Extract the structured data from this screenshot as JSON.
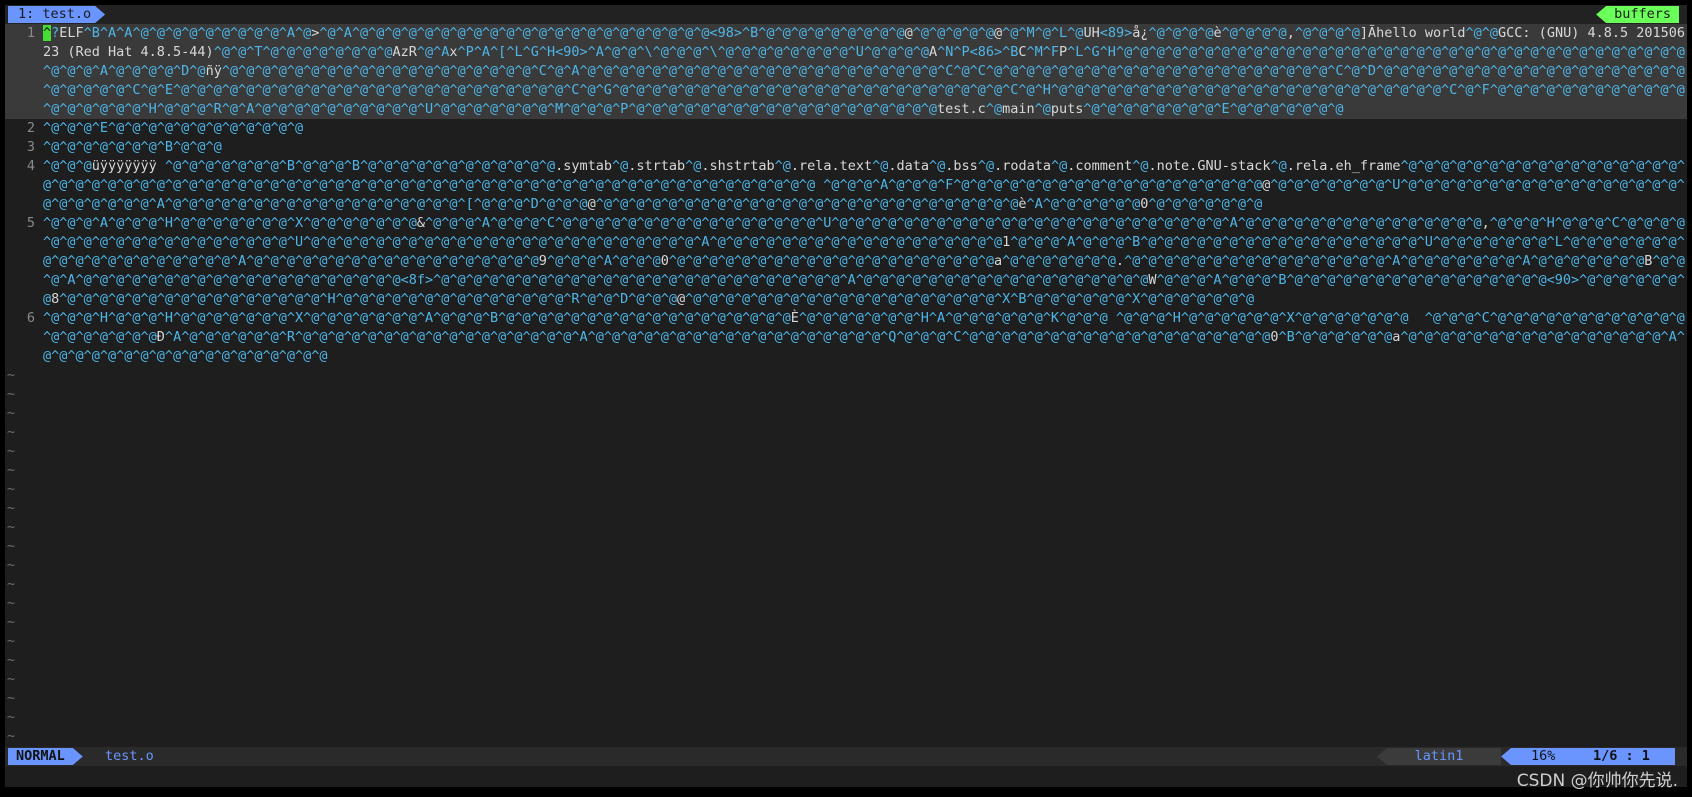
{
  "tabline": {
    "active_tab": "1: test.o",
    "buffers_label": "buffers"
  },
  "colors": {
    "background": "#1e1e1e",
    "control_chars": "#4fb6e8",
    "plain_text": "#d8d8d8",
    "cursor": "#44dd33",
    "accent_blue": "#6a95ff",
    "accent_green": "#6bff5a"
  },
  "editor": {
    "lines": [
      {
        "num": "1",
        "current": true,
        "segments": [
          {
            "t": "^",
            "k": "cursor"
          },
          {
            "t": "?",
            "k": "ctl"
          },
          {
            "t": "ELF",
            "k": "txt"
          },
          {
            "t": "^B^A^A^@^@^@^@^@^@^@^@^@^A^@",
            "k": "ctl"
          },
          {
            "t": ">",
            "k": "txt"
          },
          {
            "t": "^@^A^@^@^@^@^@^@^@^@^@^@^@^@^@^@^@^@^@^@^@^@^@^@<98>^B^@^@^@^@^@^@^@^@^@",
            "k": "ctl"
          },
          {
            "t": "@",
            "k": "txt"
          },
          {
            "t": "^@^@^@^@^@",
            "k": "ctl"
          },
          {
            "t": "@",
            "k": "txt"
          },
          {
            "t": "^@^M^@^L^@",
            "k": "ctl"
          },
          {
            "t": "UH",
            "k": "txt"
          },
          {
            "t": "<89>",
            "k": "ctl"
          },
          {
            "t": "å¿",
            "k": "txt"
          },
          {
            "t": "^@^@^@^@",
            "k": "ctl"
          },
          {
            "t": "è",
            "k": "txt"
          },
          {
            "t": "^@^@^@^@",
            "k": "ctl"
          },
          {
            "t": ",",
            "k": "txt"
          },
          {
            "t": "^@^@^@^@",
            "k": "ctl"
          },
          {
            "t": "]Ãhello world",
            "k": "txt"
          },
          {
            "t": "^@^@",
            "k": "ctl"
          },
          {
            "t": "GCC: (GNU) 4.8.5 20150623 (Red Hat 4.8.5-44)",
            "k": "txt"
          },
          {
            "t": "^@^@^T^@^@^@^@^@^@^@^@",
            "k": "ctl"
          },
          {
            "t": "AzR",
            "k": "txt"
          },
          {
            "t": "^@^A",
            "k": "ctl"
          },
          {
            "t": "x",
            "k": "txt"
          },
          {
            "t": "^P^A^[^L^G^H<90>^A^@^@^\\^@^@^@^\\^@^@^@^@^@^@^@^@^U^@^@^@^@",
            "k": "ctl"
          },
          {
            "t": "A",
            "k": "txt"
          },
          {
            "t": "^N^P<86>^B",
            "k": "ctl"
          },
          {
            "t": "C",
            "k": "txt"
          },
          {
            "t": "^M^F",
            "k": "ctl"
          },
          {
            "t": "P",
            "k": "txt"
          },
          {
            "t": "^L^G^H^@^@^@^@^@^@^@^@^@^@^@^@^@^@^@^@^@^@^@^@^@^@^@^@^@^@^@^@^@^@^@^@^@^@^@^@^@^@^A^@^@^@^@^D^@",
            "k": "ctl"
          },
          {
            "t": "ñÿ",
            "k": "txt"
          },
          {
            "t": "^@^@^@^@^@^@^@^@^@^@^@^@^@^@^@^@^@^@^@^C^@^A^@^@^@^@^@^@^@^@^@^@^@^@^@^@^@^@^@^@^@^@^@^@^C^@^C^@^@^@^@^@^@^@^@^@^@^@^@^@^@^@^@^@^@^@^@^@^C^@^D^@^@^@^@^@^@^@^@^@^@^@^@^@^@^@^@^@^@^@^@^@^@^@^@^C^@^E^@^@^@^@^@^@^@^@^@^@^@^@^@^@^@^@^@^@^@^@^@^@^@^@^C^@^G^@^@^@^@^@^@^@^@^@^@^@^@^@^@^@^@^@^@^@^@^@^@^@^@^C^@^H^@^@^@^@^@^@^@^@^@^@^@^@^@^@^@^@^@^@^@^@^@^@^@^@^C^@^F^@^@^@^@^@^@^@^@^@^@^@^@^@^@^@^@^@^@^H^@^@^@^R^@^A^@^@^@^@^@^@^@^@^@^@^U^@^@^@^@^@^@^@^M^@^@^@^P^@^@^@^@^@^@^@^@^@^@^@^@^@^@^@^@^@^@^@",
            "k": "ctl"
          },
          {
            "t": "test.c",
            "k": "txt"
          },
          {
            "t": "^@",
            "k": "ctl"
          },
          {
            "t": "main",
            "k": "txt"
          },
          {
            "t": "^@",
            "k": "ctl"
          },
          {
            "t": "puts",
            "k": "txt"
          },
          {
            "t": "^@^@^@^@^@^@^@^@^E^@^@^@^@^@^@^@",
            "k": "ctl"
          }
        ]
      },
      {
        "num": "2",
        "current": false,
        "segments": [
          {
            "t": "^@^@^@^E^@^@^@^@^@^@^@^@^@^@^@^@",
            "k": "ctl"
          }
        ]
      },
      {
        "num": "3",
        "current": false,
        "segments": [
          {
            "t": "^@^@^@^@^@^@^@^B^@^@^@",
            "k": "ctl"
          }
        ]
      },
      {
        "num": "4",
        "current": false,
        "segments": [
          {
            "t": "^@^@^@",
            "k": "ctl"
          },
          {
            "t": "üÿÿÿÿÿÿÿ ",
            "k": "txt"
          },
          {
            "t": "^@^@^@^@^@^@^@^B^@^@^@^B^@^@^@^@^@^@^@^@^@^@^@^@",
            "k": "ctl"
          },
          {
            "t": ".symtab",
            "k": "txt"
          },
          {
            "t": "^@",
            "k": "ctl"
          },
          {
            "t": ".strtab",
            "k": "txt"
          },
          {
            "t": "^@",
            "k": "ctl"
          },
          {
            "t": ".shstrtab",
            "k": "txt"
          },
          {
            "t": "^@",
            "k": "ctl"
          },
          {
            "t": ".rela.text",
            "k": "txt"
          },
          {
            "t": "^@",
            "k": "ctl"
          },
          {
            "t": ".data",
            "k": "txt"
          },
          {
            "t": "^@",
            "k": "ctl"
          },
          {
            "t": ".bss",
            "k": "txt"
          },
          {
            "t": "^@",
            "k": "ctl"
          },
          {
            "t": ".rodata",
            "k": "txt"
          },
          {
            "t": "^@",
            "k": "ctl"
          },
          {
            "t": ".comment",
            "k": "txt"
          },
          {
            "t": "^@",
            "k": "ctl"
          },
          {
            "t": ".note.GNU-stack",
            "k": "txt"
          },
          {
            "t": "^@",
            "k": "ctl"
          },
          {
            "t": ".rela.eh_frame",
            "k": "txt"
          },
          {
            "t": "^@^@^@^@^@^@^@^@^@^@^@^@^@^@^@^@^@^@^@^@^@^@^@^@^@^@^@^@^@^@^@^@^@^@^@^@^@^@^@^@^@^@^@^@^@^@^@^@^@^@^@^@^@^@^@^@^@^@^@^@^@^@^@^@^@ ^@^@^@^A^@^@^@^F^@^@^@^@^@^@^@^@^@^@^@^@^@^@^@^@^@^@^@",
            "k": "ctl"
          },
          {
            "t": "@",
            "k": "txt"
          },
          {
            "t": "^@^@^@^@^@^@^@^U^@^@^@^@^@^@^@^@^@^@^@^@^@^@^@^@^@^@^@^@^@^@^@^@^A^@^@^@^@^@^@^@^@^@^@^@^@^@^@^@^@^@^@^[^@^@^@^D^@^@^@",
            "k": "ctl"
          },
          {
            "t": "@",
            "k": "txt"
          },
          {
            "t": "^@^@^@^@^@^@^@^@^@^@^@^@^@^@^@^@^@^@^@^@^@^@^@^@^@^@",
            "k": "ctl"
          },
          {
            "t": "è",
            "k": "txt"
          },
          {
            "t": "^A^@^@^@^@^@^@",
            "k": "ctl"
          },
          {
            "t": "0",
            "k": "txt"
          },
          {
            "t": "^@^@^@^@^@^@^@",
            "k": "ctl"
          }
        ]
      },
      {
        "num": "5",
        "current": false,
        "segments": [
          {
            "t": "^@^@^@^A^@^@^@^H^@^@^@^@^@^@^@^X^@^@^@^@^@^@^@",
            "k": "ctl"
          },
          {
            "t": "&",
            "k": "txt"
          },
          {
            "t": "^@^@^@^A^@^@^@^C^@^@^@^@^@^@^@^@^@^@^@^@^@^@^@^@^U^@^@^@^@^@^@^@^@^@^@^@^@^@^@^@^@^@^@^@^@^@^@^@^@^A^@^@^@^@^@^@^@^@^@^@^@^@^@^@^@",
            "k": "ctl"
          },
          {
            "t": ",",
            "k": "txt"
          },
          {
            "t": "^@^@^@^H^@^@^@^C^@^@^@^@^@^@^@^@^@^@^@^@^@^@^@^@^@^@^@^U^@^@^@^@^@^@^@^@^@^@^@^@^@^@^@^@^@^@^@^@^@^@^@^@^A^@^@^@^@^@^@^@^@^@^@^@^@^@^@^@^@^@^@",
            "k": "ctl"
          },
          {
            "t": "1",
            "k": "txt"
          },
          {
            "t": "^@^@^@^A^@^@^@^B^@^@^@^@^@^@^@^@^@^@^@^@^@^@^@^@^@^U^@^@^@^@^@^@^@^L^@^@^@^@^@^@^@^@^@^@^@^@^@^@^@^@^@^@^@^A^@^@^@^@^@^@^@^@^@^@^@^@^@^@^@^@^@^@",
            "k": "ctl"
          },
          {
            "t": "9",
            "k": "txt"
          },
          {
            "t": "^@^@^@^A^@^@^@",
            "k": "ctl"
          },
          {
            "t": "0",
            "k": "txt"
          },
          {
            "t": "^@^@^@^@^@^@^@^@^@^@^@^@^@^@^@^@^@^@^@^@",
            "k": "ctl"
          },
          {
            "t": "a",
            "k": "txt"
          },
          {
            "t": "^@^@^@^@^@^@^@",
            "k": "ctl"
          },
          {
            "t": ".",
            "k": "txt"
          },
          {
            "t": "^@^@^@^@^@^@^@^@^@^@^@^@^@^@^@^@^A^@^@^@^@^@^@^@^A^@^@^@^@^@^@^@",
            "k": "ctl"
          },
          {
            "t": "B",
            "k": "txt"
          },
          {
            "t": "^@^@^@^A^@^@^@^@^@^@^@^@^@^@^@^@^@^@^@^@^@^@^@^@<8f>^@^@^@^@^@^@^@^@^@^@^@^@^@^@^@^@^@^@^@^@^@^@^@^@^@^A^@^@^@^@^@^@^@^@^@^@^@^@^@^@^@^@^@^@",
            "k": "ctl"
          },
          {
            "t": "W",
            "k": "txt"
          },
          {
            "t": "^@^@^@^A^@^@^@^B^@^@^@^@^@^@^@^@^@^@^@^@^@^@^@^@<90>^@^@^@^@^@^@^@",
            "k": "ctl"
          },
          {
            "t": "8",
            "k": "txt"
          },
          {
            "t": "^@^@^@^@^@^@^@^@^@^@^@^@^@^@^@^@^H^@^@^@^@^@^@^@^@^@^@^@^@^@^@^R^@^@^D^@^@^@",
            "k": "ctl"
          },
          {
            "t": "@",
            "k": "txt"
          },
          {
            "t": "^@^@^@^@^@^@^@^@^@^@^@^@^@^@^@^@^@^@^@^X^B^@^@^@^@^@^@^X^@^@^@^@^@^@^@",
            "k": "ctl"
          }
        ]
      },
      {
        "num": "6",
        "current": false,
        "segments": [
          {
            "t": "^@^@^@^H^@^@^@^H^@^@^@^@^@^@^@^X^@^@^@^@^@^@^@^A^@^@^@^B^@^@^@^@^@^@^@^@^@^@^@^@^@^@^@^@^@^@",
            "k": "ctl"
          },
          {
            "t": "È",
            "k": "txt"
          },
          {
            "t": "^@^@^@^@^@^@^@^H^A^@^@^@^@^@^@^K^@^@^@ ^@^@^@^H^@^@^@^@^@^@^X^@^@^@^@^@^@^@  ^@^@^@^C^@^@^@^@^@^@^@^@^@^@^@^@^@^@^@^@^@^@^@",
            "k": "ctl"
          },
          {
            "t": "Ð",
            "k": "txt"
          },
          {
            "t": "^A^@^@^@^@^@^@^R^@^@^@^@^@^@^@^@^@^@^@^@^@^@^@^@^@^A^@^@^@^@^@^@^@^@^@^@^@^@^@^@^@^@^@^@^Q^@^@^@^C^@^@^@^@^@^@^@^@^@^@^@^@^@^@^@^@^@^@^@",
            "k": "ctl"
          },
          {
            "t": "0",
            "k": "txt"
          },
          {
            "t": "^B^@^@^@^@^@^@",
            "k": "ctl"
          },
          {
            "t": "a",
            "k": "txt"
          },
          {
            "t": "^@^@^@^@^@^@^@^@^@^@^@^@^@^@^@^@^A^@^@^@^@^@^@^@^@^@^@^@^@^@^@^@^@^@^@",
            "k": "ctl"
          }
        ]
      }
    ],
    "filler_lines": [
      "~",
      "~",
      "~",
      "~",
      "~",
      "~",
      "~",
      "~",
      "~",
      "~",
      "~",
      "~",
      "~",
      "~",
      "~",
      "~",
      "~",
      "~",
      "~",
      "~"
    ]
  },
  "statusline": {
    "mode": "NORMAL",
    "filename": "test.o",
    "encoding": "latin1",
    "percent": "16%",
    "cursor_pos": "1/6 :  1"
  },
  "watermark": "CSDN @你帅你先说."
}
